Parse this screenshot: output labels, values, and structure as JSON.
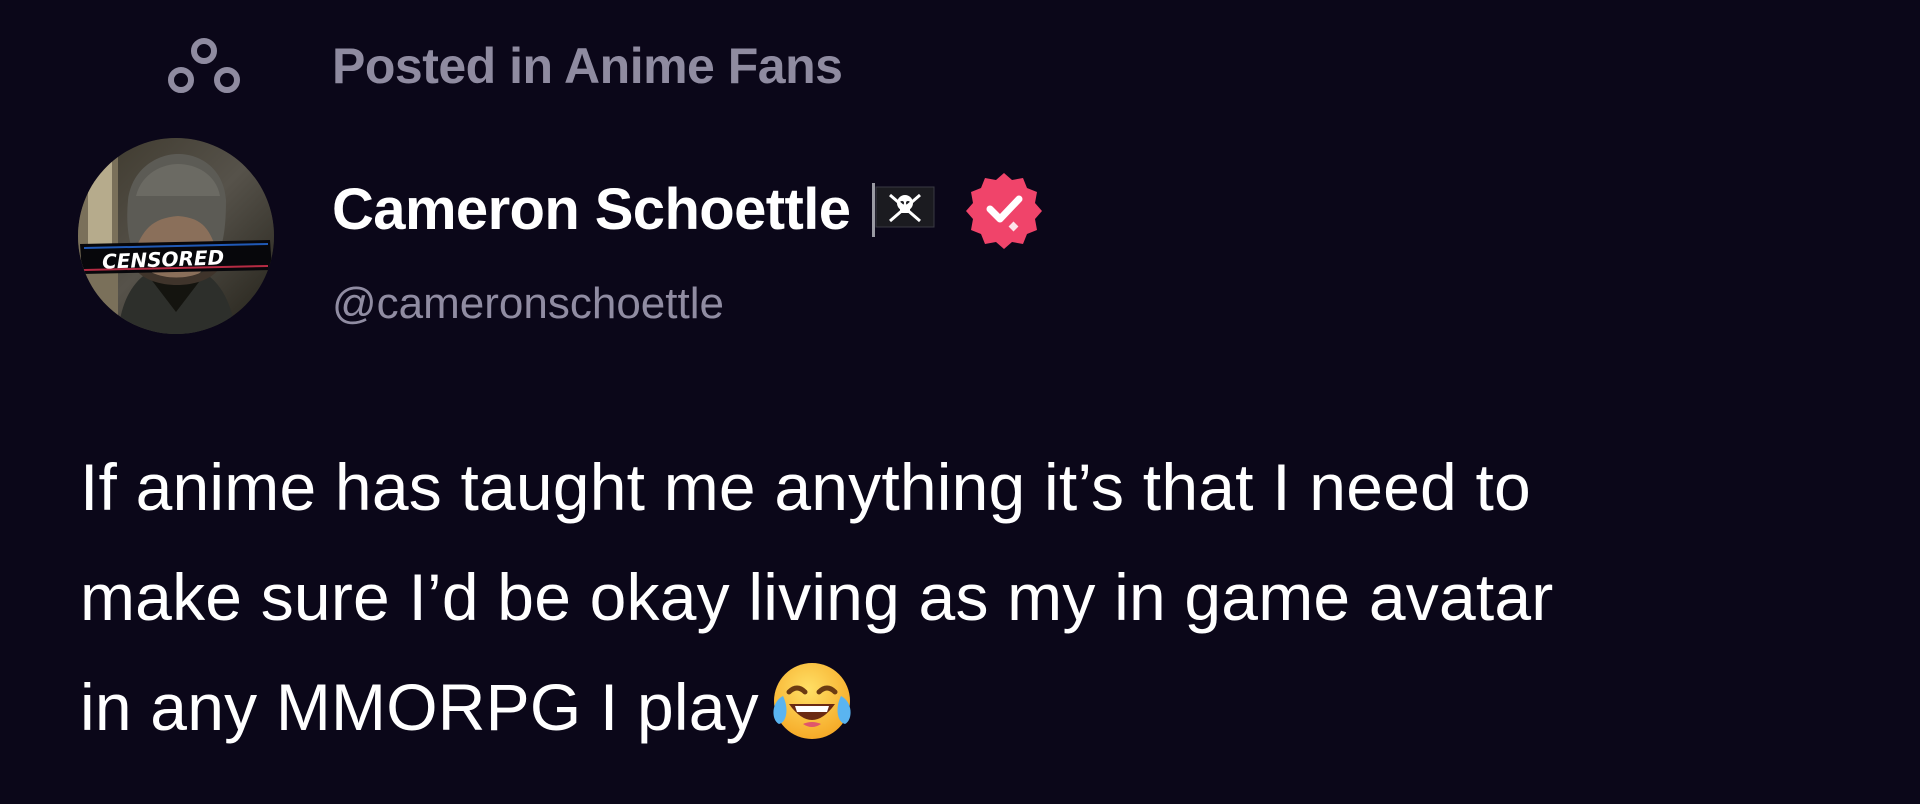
{
  "post": {
    "context": {
      "prefix": "Posted in",
      "community": "Anime Fans",
      "text": "Posted in Anime Fans",
      "icon": "community-icon"
    },
    "author": {
      "name": "Cameron Schoettle",
      "handle": "@cameronschoettle",
      "avatar_label": "CENSORED",
      "badges": [
        "pirate-flag-icon",
        "verified-badge-icon"
      ]
    },
    "body": {
      "lines": [
        "If anime has taught me anything it’s that I need to",
        "make sure I’d be okay living as my in game avatar",
        "in any MMORPG I play"
      ],
      "emoji": "face-with-tears-of-joy-icon"
    }
  },
  "colors": {
    "background": "#0b0719",
    "primary_text": "#ffffff",
    "secondary_text": "#8f8ba0",
    "verified_badge": "#f0446a"
  }
}
